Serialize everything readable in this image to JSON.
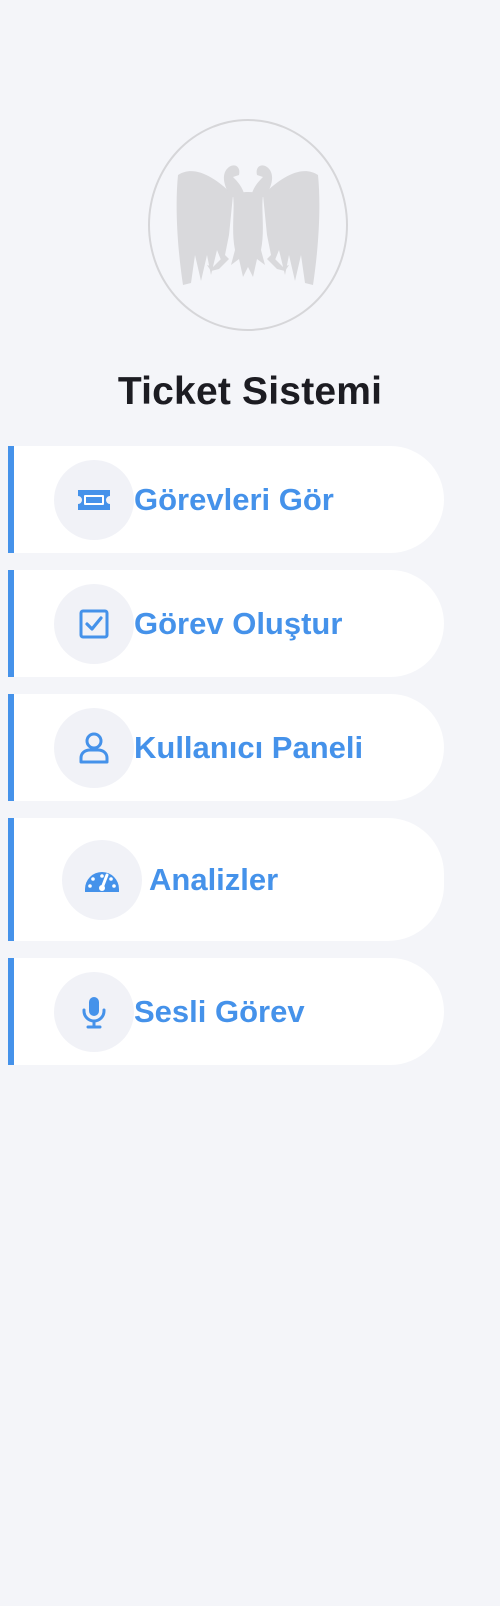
{
  "app": {
    "title": "Ticket Sistemi",
    "accent_color": "#4592ea",
    "logo_icon": "double-headed-eagle-icon"
  },
  "nav": {
    "items": [
      {
        "label": "Görevleri Gör",
        "icon": "ticket-icon"
      },
      {
        "label": "Görev Oluştur",
        "icon": "checkbox-icon"
      },
      {
        "label": "Kullanıcı Paneli",
        "icon": "user-icon"
      },
      {
        "label": "Analizler",
        "icon": "gauge-icon"
      },
      {
        "label": "Sesli Görev",
        "icon": "microphone-icon"
      }
    ]
  }
}
